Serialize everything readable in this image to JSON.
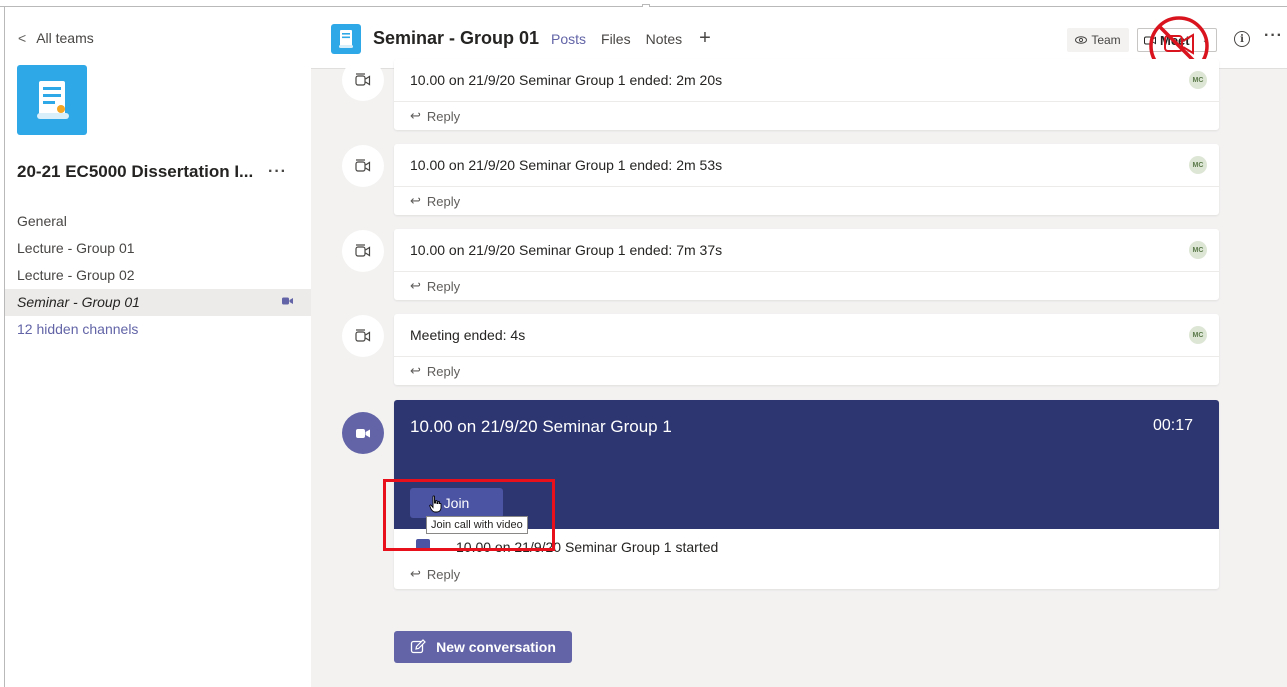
{
  "sidebar": {
    "back_label": "All teams",
    "team_name": "20-21 EC5000 Dissertation I...",
    "team_menu": "···",
    "channels": [
      {
        "label": "General"
      },
      {
        "label": "Lecture - Group 01"
      },
      {
        "label": "Lecture - Group 02"
      },
      {
        "label": "Seminar - Group 01"
      },
      {
        "label": "12 hidden channels"
      }
    ]
  },
  "header": {
    "title": "Seminar - Group 01",
    "tabs": [
      {
        "label": "Posts"
      },
      {
        "label": "Files"
      },
      {
        "label": "Notes"
      },
      {
        "label": "+"
      }
    ],
    "team_button": "Team",
    "meet_button": "Meet",
    "more": "···"
  },
  "posts": [
    {
      "text": "10.00 on 21/9/20 Seminar Group 1 ended: 2m 20s",
      "avatar": "MC",
      "reply": "Reply"
    },
    {
      "text": "10.00 on 21/9/20 Seminar Group 1 ended: 2m 53s",
      "avatar": "MC",
      "reply": "Reply"
    },
    {
      "text": "10.00 on 21/9/20 Seminar Group 1 ended: 7m 37s",
      "avatar": "MC",
      "reply": "Reply"
    },
    {
      "text": "Meeting ended: 4s",
      "avatar": "MC",
      "reply": "Reply"
    }
  ],
  "meeting": {
    "title": "10.00 on 21/9/20 Seminar Group 1",
    "timer": "00:17",
    "join_label": "Join",
    "tooltip": "Join call with video",
    "started_text": "10.00 on 21/9/20 Seminar Group 1 started",
    "reply": "Reply"
  },
  "new_conversation": "New conversation",
  "colors": {
    "accent": "#6264a7",
    "meeting_banner": "#2d3670",
    "highlight": "#e8101b",
    "team_tile": "#2ea8e6"
  }
}
